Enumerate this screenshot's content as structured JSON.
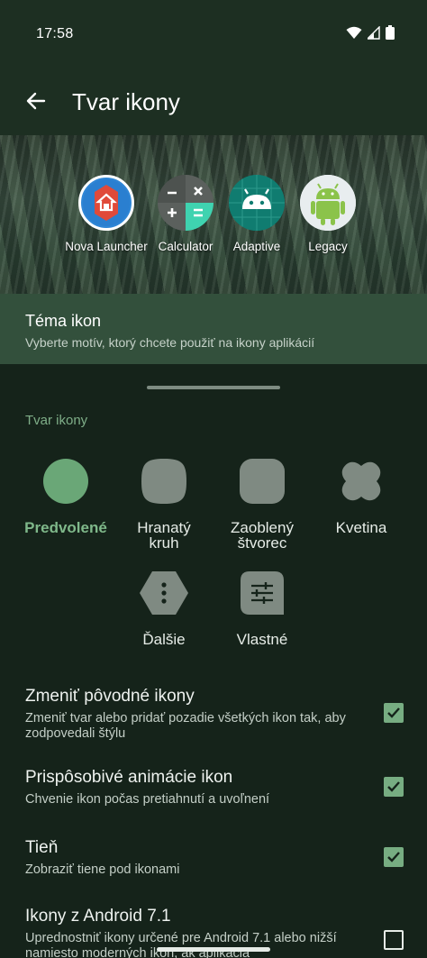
{
  "status_bar": {
    "time": "17:58",
    "icons": [
      "wifi-icon",
      "signal-icon",
      "battery-icon"
    ]
  },
  "app_bar": {
    "title": "Tvar ikony",
    "back_icon": "arrow-back-icon"
  },
  "preview": {
    "apps": [
      {
        "label": "Nova Launcher",
        "icon": "nova-launcher-icon"
      },
      {
        "label": "Calculator",
        "icon": "calculator-icon"
      },
      {
        "label": "Adaptive",
        "icon": "android-adaptive-icon"
      },
      {
        "label": "Legacy",
        "icon": "android-legacy-icon"
      }
    ]
  },
  "theme": {
    "title": "Téma ikon",
    "subtitle": "Vyberte motív, ktorý chcete použiť na ikony aplikácií"
  },
  "shape_section": {
    "title": "Tvar ikony",
    "options": [
      {
        "label": "Predvolené",
        "selected": true
      },
      {
        "label": "Hranatý kruh",
        "selected": false
      },
      {
        "label": "Zaoblený štvorec",
        "selected": false
      },
      {
        "label": "Kvetina",
        "selected": false
      },
      {
        "label": "Ďalšie",
        "selected": false
      },
      {
        "label": "Vlastné",
        "selected": false
      }
    ]
  },
  "settings": [
    {
      "title": "Zmeniť pôvodné ikony",
      "desc": "Zmeniť tvar alebo pridať pozadie všetkých ikon tak, aby zodpovedali štýlu",
      "checked": true
    },
    {
      "title": "Prispôsobivé animácie ikon",
      "desc": "Chvenie ikon počas pretiahnutí a uvoľnení",
      "checked": true
    },
    {
      "title": "Tieň",
      "desc": "Zobraziť tiene pod ikonami",
      "checked": true
    },
    {
      "title": "Ikony z Android 7.1",
      "desc": "Uprednostniť ikony určené pre Android 7.1 alebo nižší namiesto moderných ikon, ak aplikácia",
      "checked": false
    }
  ],
  "colors": {
    "accent": "#77ad82",
    "background": "#15231a",
    "header": "#1d2f22",
    "theme_row": "#33503c",
    "shape_fill": "#7f8a82",
    "shape_selected": "#6aa777"
  }
}
